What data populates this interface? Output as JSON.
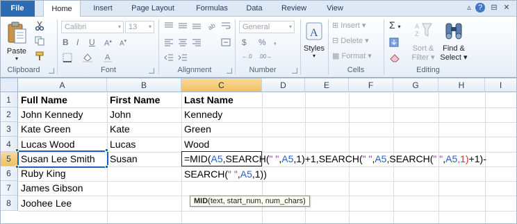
{
  "tabs": [
    {
      "label": "File"
    },
    {
      "label": "Home"
    },
    {
      "label": "Insert"
    },
    {
      "label": "Page Layout"
    },
    {
      "label": "Formulas"
    },
    {
      "label": "Data"
    },
    {
      "label": "Review"
    },
    {
      "label": "View"
    }
  ],
  "window_controls": [
    "▵",
    "?",
    "⊟",
    "✕"
  ],
  "ribbon": {
    "clipboard": {
      "label": "Clipboard",
      "paste": "Paste"
    },
    "font": {
      "label": "Font",
      "font_name": "Calibri",
      "font_size": "13",
      "bold": "B",
      "italic": "I",
      "underline": "U"
    },
    "alignment": {
      "label": "Alignment"
    },
    "number": {
      "label": "Number",
      "format": "General",
      "currency": "$",
      "percent": "%",
      "comma": ","
    },
    "styles": {
      "label": "Styles"
    },
    "cells": {
      "label": "Cells",
      "insert": "Insert",
      "delete": "Delete",
      "format": "Format"
    },
    "editing": {
      "label": "Editing",
      "sort": "Sort &",
      "filter": "Filter",
      "find": "Find &",
      "select": "Select"
    }
  },
  "grid": {
    "columns": [
      "A",
      "B",
      "C",
      "D",
      "E",
      "F",
      "G",
      "H",
      "I"
    ],
    "rows": [
      "1",
      "2",
      "3",
      "4",
      "5",
      "6",
      "7",
      "8"
    ],
    "active_column": "C",
    "active_row": "5",
    "cells": {
      "A1": "Full Name",
      "B1": "First Name",
      "C1": "Last Name",
      "A2": "John Kennedy",
      "B2": "John",
      "C2": "Kennedy",
      "A3": "Kate Green",
      "B3": "Kate",
      "C3": "Green",
      "A4": "Lucas Wood",
      "B4": "Lucas",
      "C4": "Wood",
      "A5": "Susan Lee Smith",
      "B5": "Susan",
      "A6": "Ruby King",
      "A7": "James Gibson",
      "A8": "Joohee Lee"
    }
  },
  "formula_edit": {
    "line1": [
      {
        "t": "=MI",
        "c": ""
      },
      {
        "t": "D(",
        "c": ""
      },
      {
        "t": "A5",
        "c": "blue"
      },
      {
        "t": ",SEARCH(",
        "c": ""
      },
      {
        "t": "\" \"",
        "c": "purple"
      },
      {
        "t": ",",
        "c": ""
      },
      {
        "t": "A5",
        "c": "blue"
      },
      {
        "t": ",1)+1,SEARCH(",
        "c": ""
      },
      {
        "t": "\" \"",
        "c": "purple"
      },
      {
        "t": ",",
        "c": ""
      },
      {
        "t": "A5",
        "c": "blue"
      },
      {
        "t": ",SEARCH(",
        "c": ""
      },
      {
        "t": "\" \"",
        "c": "purple"
      },
      {
        "t": ",",
        "c": ""
      },
      {
        "t": "A5",
        "c": "blue"
      },
      {
        "t": ",1)",
        "c": "red"
      },
      {
        "t": "+1)-",
        "c": ""
      }
    ],
    "line2": [
      {
        "t": "SEARCH(",
        "c": ""
      },
      {
        "t": "\" \"",
        "c": "purple"
      },
      {
        "t": ",",
        "c": ""
      },
      {
        "t": "A5",
        "c": "blue"
      },
      {
        "t": ",1))",
        "c": ""
      }
    ],
    "tooltip_fn": "MID",
    "tooltip_args": "(text, start_num, num_chars)"
  },
  "colors": {
    "file_tab": "#2d6bb3",
    "selection": "#1b5fbf",
    "ref_blue": "#2a5fc2",
    "ref_purple": "#8b3ea0",
    "ref_red": "#c73a3a"
  }
}
